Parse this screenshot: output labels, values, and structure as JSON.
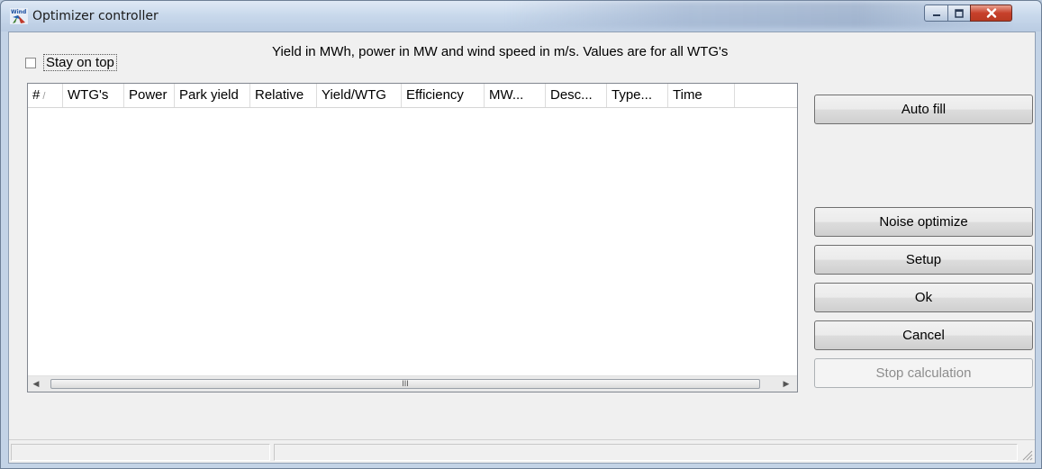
{
  "window": {
    "title": "Optimizer controller",
    "icon": "windpro-app-icon",
    "controls": [
      "minimize-icon",
      "maximize-icon",
      "close-icon"
    ]
  },
  "stay_on_top": {
    "label": "Stay on top",
    "checked": false
  },
  "info_text": "Yield in MWh, power in MW and wind speed in m/s. Values are for all WTG's",
  "table": {
    "columns": [
      {
        "label": "#"
      },
      {
        "label": "WTG's"
      },
      {
        "label": "Power"
      },
      {
        "label": "Park yield"
      },
      {
        "label": "Relative"
      },
      {
        "label": "Yield/WTG"
      },
      {
        "label": "Efficiency"
      },
      {
        "label": "MW..."
      },
      {
        "label": "Desc..."
      },
      {
        "label": "Type..."
      },
      {
        "label": "Time"
      }
    ],
    "rows": [],
    "scroll_glyph": "III"
  },
  "buttons": {
    "auto_fill": "Auto fill",
    "noise_optimize": "Noise optimize",
    "setup": "Setup",
    "ok": "Ok",
    "cancel": "Cancel",
    "stop_calculation": "Stop calculation"
  },
  "status_bar": {
    "panel1": "",
    "panel2": ""
  }
}
